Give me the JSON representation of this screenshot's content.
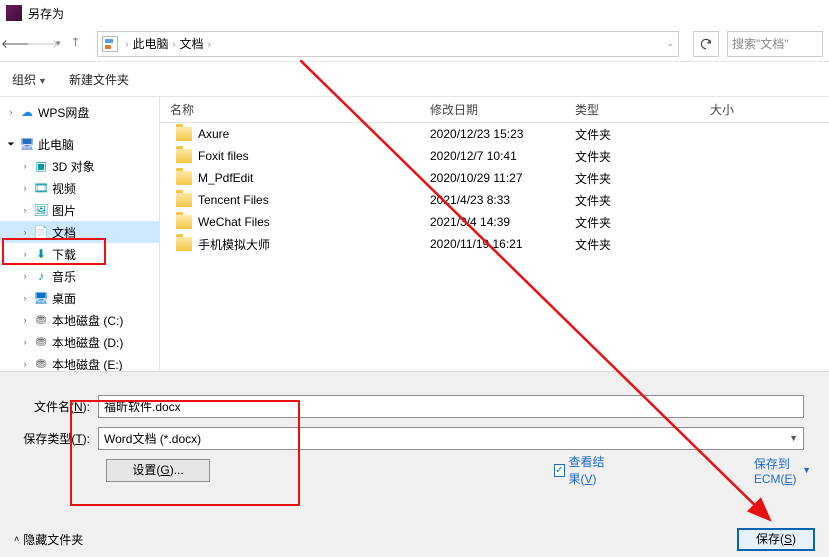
{
  "titlebar": {
    "title": "另存为"
  },
  "path": {
    "seg1": "此电脑",
    "seg2": "文档"
  },
  "search": {
    "placeholder": "搜索\"文档\""
  },
  "toolbar": {
    "organize": "组织",
    "newfolder": "新建文件夹"
  },
  "sidebar": {
    "items": [
      {
        "label": "WPS网盘",
        "kind": "cloud",
        "lvl": 1,
        "arrow": ">"
      },
      {
        "label": "此电脑",
        "kind": "pc",
        "lvl": 1,
        "arrow": "v"
      },
      {
        "label": "3D 对象",
        "kind": "3d",
        "lvl": 2,
        "arrow": ">"
      },
      {
        "label": "视频",
        "kind": "video",
        "lvl": 2,
        "arrow": ">"
      },
      {
        "label": "图片",
        "kind": "pic",
        "lvl": 2,
        "arrow": ">"
      },
      {
        "label": "文档",
        "kind": "doc",
        "lvl": 2,
        "arrow": ">",
        "selected": true
      },
      {
        "label": "下载",
        "kind": "dl",
        "lvl": 2,
        "arrow": ">"
      },
      {
        "label": "音乐",
        "kind": "music",
        "lvl": 2,
        "arrow": ">"
      },
      {
        "label": "桌面",
        "kind": "desktop",
        "lvl": 2,
        "arrow": ">"
      },
      {
        "label": "本地磁盘 (C:)",
        "kind": "disk",
        "lvl": 2,
        "arrow": ">"
      },
      {
        "label": "本地磁盘 (D:)",
        "kind": "disk",
        "lvl": 2,
        "arrow": ">"
      },
      {
        "label": "本地磁盘 (E:)",
        "kind": "disk",
        "lvl": 2,
        "arrow": ">"
      }
    ]
  },
  "columns": {
    "name": "名称",
    "date": "修改日期",
    "type": "类型",
    "size": "大小"
  },
  "rows": [
    {
      "name": "Axure",
      "date": "2020/12/23 15:23",
      "type": "文件夹"
    },
    {
      "name": "Foxit files",
      "date": "2020/12/7 10:41",
      "type": "文件夹"
    },
    {
      "name": "M_PdfEdit",
      "date": "2020/10/29 11:27",
      "type": "文件夹"
    },
    {
      "name": "Tencent Files",
      "date": "2021/4/23 8:33",
      "type": "文件夹"
    },
    {
      "name": "WeChat Files",
      "date": "2021/3/4 14:39",
      "type": "文件夹"
    },
    {
      "name": "手机模拟大师",
      "date": "2020/11/19 16:21",
      "type": "文件夹"
    }
  ],
  "form": {
    "filename_label_pre": "文件名(",
    "filename_label_key": "N",
    "filename_label_post": "):",
    "filename_value": "福昕软件.docx",
    "filetype_label_pre": "保存类型(",
    "filetype_label_key": "T",
    "filetype_label_post": "):",
    "filetype_value": "Word文档 (*.docx)",
    "settings_pre": "设置(",
    "settings_key": "G",
    "settings_post": ")...",
    "viewresult_pre": "查看结果(",
    "viewresult_key": "V",
    "viewresult_post": ")",
    "ecm_pre": "保存到ECM(",
    "ecm_key": "E",
    "ecm_post": ")"
  },
  "footer": {
    "hide": "隐藏文件夹",
    "save_pre": "保存(",
    "save_key": "S",
    "save_post": ")"
  }
}
